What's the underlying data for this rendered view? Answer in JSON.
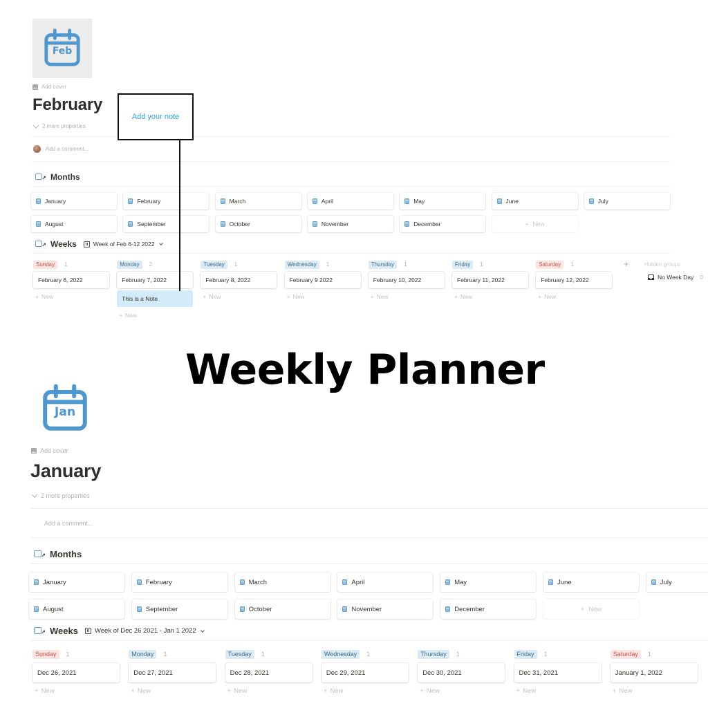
{
  "headline": "Weekly Planner",
  "annotation": {
    "label": "Add your note"
  },
  "pages": [
    {
      "icon_label": "Feb",
      "add_cover": "Add cover",
      "title": "February",
      "more_properties": "2 more properties",
      "comment_placeholder": "Add a comment...",
      "months_title": "Months",
      "months": [
        "January",
        "February",
        "March",
        "April",
        "May",
        "June",
        "July",
        "August",
        "September",
        "October",
        "November",
        "December"
      ],
      "new_label": "New",
      "weeks_title": "Weeks",
      "week_view": "Week of Feb 6-12 2022",
      "columns": [
        {
          "day": "Sunday",
          "color": "red",
          "count": "1",
          "cards": [
            "February 6, 2022"
          ]
        },
        {
          "day": "Monday",
          "color": "blue",
          "count": "2",
          "cards": [
            "February 7, 2022"
          ],
          "note": "This is a Note"
        },
        {
          "day": "Tuesday",
          "color": "blue",
          "count": "1",
          "cards": [
            "February 8, 2022"
          ]
        },
        {
          "day": "Wednesday",
          "color": "blue",
          "count": "1",
          "cards": [
            "February 9 2022"
          ]
        },
        {
          "day": "Thursday",
          "color": "blue",
          "count": "1",
          "cards": [
            "February 10, 2022"
          ]
        },
        {
          "day": "Friday",
          "color": "blue",
          "count": "1",
          "cards": [
            "February 11, 2022"
          ]
        },
        {
          "day": "Saturday",
          "color": "red",
          "count": "1",
          "cards": [
            "February 12, 2022"
          ]
        }
      ],
      "hidden_groups": "Hidden groups",
      "no_week_day": {
        "label": "No Week Day",
        "count": "0"
      }
    },
    {
      "icon_label": "Jan",
      "add_cover": "Add cover",
      "title": "January",
      "more_properties": "2 more properties",
      "comment_placeholder": "Add a comment...",
      "months_title": "Months",
      "months": [
        "January",
        "February",
        "March",
        "April",
        "May",
        "June",
        "July",
        "August",
        "September",
        "October",
        "November",
        "December"
      ],
      "new_label": "New",
      "weeks_title": "Weeks",
      "week_view": "Week of Dec 26 2021 - Jan 1 2022",
      "columns": [
        {
          "day": "Sunday",
          "color": "red",
          "count": "1",
          "cards": [
            "Dec 26, 2021"
          ]
        },
        {
          "day": "Monday",
          "color": "blue",
          "count": "1",
          "cards": [
            "Dec 27, 2021"
          ]
        },
        {
          "day": "Tuesday",
          "color": "blue",
          "count": "1",
          "cards": [
            "Dec 28, 2021"
          ]
        },
        {
          "day": "Wednesday",
          "color": "blue",
          "count": "1",
          "cards": [
            "Dec 29, 2021"
          ]
        },
        {
          "day": "Thursday",
          "color": "blue",
          "count": "1",
          "cards": [
            "Dec 30, 2021"
          ]
        },
        {
          "day": "Friday",
          "color": "blue",
          "count": "1",
          "cards": [
            "Dec 31, 2021"
          ]
        },
        {
          "day": "Saturday",
          "color": "red",
          "count": "1",
          "cards": [
            "January 1, 2022"
          ]
        }
      ]
    }
  ],
  "colors": {
    "icon_blue": "#4f97cf",
    "note_bg": "#d3ebf7",
    "annotation_text": "#2aa4e6"
  }
}
